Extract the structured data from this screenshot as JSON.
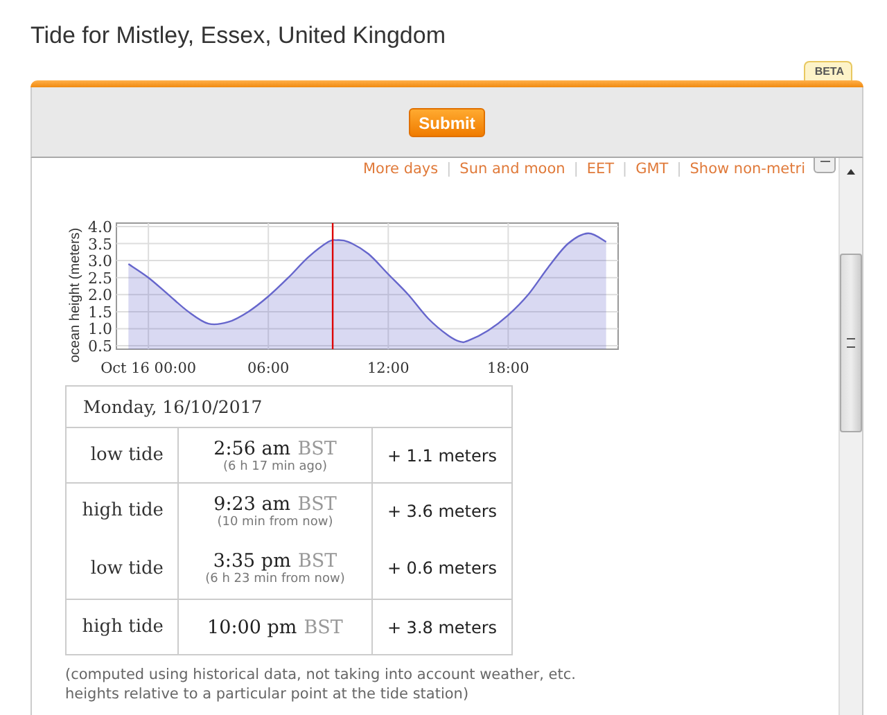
{
  "page_title": "Tide for Mistley, Essex, United Kingdom",
  "badge": "BETA",
  "submit_button": "Submit",
  "links": [
    {
      "kind": "link",
      "text": "More days"
    },
    {
      "kind": "separator",
      "text": "|"
    },
    {
      "kind": "link",
      "text": "Sun and moon"
    },
    {
      "kind": "separator",
      "text": "|"
    },
    {
      "kind": "link",
      "text": "EET"
    },
    {
      "kind": "separator",
      "text": "|"
    },
    {
      "kind": "link",
      "text": "GMT"
    },
    {
      "kind": "separator",
      "text": "|"
    },
    {
      "kind": "link",
      "text": "Show non-metri"
    }
  ],
  "chart_data": {
    "type": "area",
    "ylabel": "ocean height (meters)",
    "xlim": [
      -1.6,
      23.5
    ],
    "ylim": [
      0.4,
      4.1
    ],
    "grid": true,
    "yticks": [
      {
        "value": 0.5,
        "label": "0.5"
      },
      {
        "value": 1,
        "label": "1.0"
      },
      {
        "value": 1.5,
        "label": "1.5"
      },
      {
        "value": 2,
        "label": "2.0"
      },
      {
        "value": 2.5,
        "label": "2.5"
      },
      {
        "value": 3,
        "label": "3.0"
      },
      {
        "value": 3.5,
        "label": "3.5"
      },
      {
        "value": 4,
        "label": "4.0"
      }
    ],
    "xticks": [
      {
        "value": 0,
        "label": "Oct 16 00:00"
      },
      {
        "value": 6,
        "label": "06:00"
      },
      {
        "value": 12,
        "label": "12:00"
      },
      {
        "value": 18,
        "label": "18:00"
      }
    ],
    "x": [
      -1,
      0,
      1,
      2,
      3,
      4,
      5,
      6,
      7,
      8,
      9,
      9.4,
      10,
      11,
      12,
      13,
      14,
      15,
      15.6,
      16,
      17,
      18,
      19,
      20,
      21,
      22,
      22.9
    ],
    "series": [
      {
        "color": "#6666cc",
        "values": [
          2.9,
          2.5,
          2.0,
          1.5,
          1.15,
          1.2,
          1.5,
          1.95,
          2.5,
          3.1,
          3.55,
          3.6,
          3.55,
          3.2,
          2.6,
          2.0,
          1.3,
          0.8,
          0.62,
          0.65,
          0.95,
          1.4,
          2.0,
          2.8,
          3.5,
          3.8,
          3.55
        ]
      }
    ],
    "ref_lines": [
      {
        "axis": "x",
        "value": 9.22,
        "color": "#dd0000"
      }
    ]
  },
  "table": {
    "date": "Monday, 16/10/2017",
    "rows": [
      {
        "event": "low tide",
        "time": "2:56 am",
        "zone": "BST",
        "relative": "(6 h 17 min ago)",
        "height": "+ 1.1 meters",
        "separated": true
      },
      {
        "event": "high tide",
        "time": "9:23 am",
        "zone": "BST",
        "relative": "(10 min from now)",
        "height": "+ 3.6 meters",
        "separated": true
      },
      {
        "event": "low tide",
        "time": "3:35 pm",
        "zone": "BST",
        "relative": "(6 h 23 min from now)",
        "height": "+ 0.6 meters",
        "separated": false
      },
      {
        "event": "high tide",
        "time": "10:00 pm",
        "zone": "BST",
        "height": "+ 3.8 meters",
        "separated": true
      }
    ]
  },
  "notes": [
    "(computed using historical data, not taking into account weather, etc.",
    "heights relative to a particular point at the tide station)"
  ]
}
